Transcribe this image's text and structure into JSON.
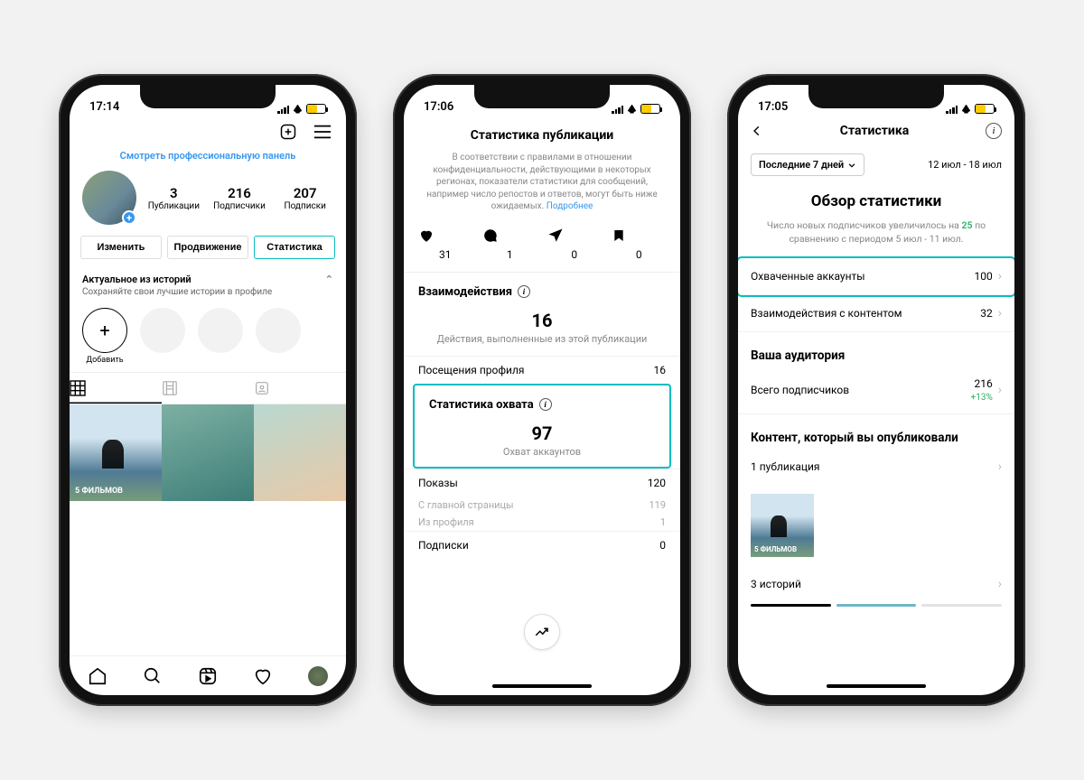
{
  "colors": {
    "accent": "#09bdc0",
    "link": "#3897f0",
    "green": "#27ae60",
    "battery": "#ffcc00"
  },
  "phone1": {
    "time": "17:14",
    "panel_link": "Смотреть профессиональную панель",
    "stats": {
      "posts": {
        "num": "3",
        "label": "Публикации"
      },
      "followers": {
        "num": "216",
        "label": "Подписчики"
      },
      "following": {
        "num": "207",
        "label": "Подписки"
      }
    },
    "tabs": {
      "edit": "Изменить",
      "promo": "Продвижение",
      "stats": "Статистика"
    },
    "highlights_title": "Актуальное из историй",
    "highlights_sub": "Сохраняйте свои лучшие истории в профиле",
    "highlights_add": "Добавить",
    "post1_text": "5 ФИЛЬМОВ"
  },
  "phone2": {
    "time": "17:06",
    "title": "Статистика публикации",
    "info": "В соответствии с правилами в отношении конфиденциальности, действующими в некоторых регионах, показатели статистики для сообщений, например число репостов и ответов, могут быть ниже ожидаемых.",
    "info_link": "Подробнее",
    "icon_counts": {
      "likes": "31",
      "comments": "1",
      "shares": "0",
      "saves": "0"
    },
    "interactions_title": "Взаимодействия",
    "interactions_value": "16",
    "interactions_sub": "Действия, выполненные из этой публикации",
    "profile_visits": {
      "label": "Посещения профиля",
      "value": "16"
    },
    "reach_title": "Статистика охвата",
    "reach_value": "97",
    "reach_sub": "Охват аккаунтов",
    "impressions": {
      "label": "Показы",
      "value": "120"
    },
    "imp_home": {
      "label": "С главной страницы",
      "value": "119"
    },
    "imp_profile": {
      "label": "Из профиля",
      "value": "1"
    },
    "follows": {
      "label": "Подписки",
      "value": "0"
    }
  },
  "phone3": {
    "time": "17:05",
    "title": "Статистика",
    "period": "Последние 7 дней",
    "date_range": "12 июл - 18 июл",
    "h2": "Обзор статистики",
    "sub_pre": "Число новых подписчиков увеличилось на ",
    "sub_green": "25",
    "sub_post": " по сравнению с периодом 5 июл - 11 июл.",
    "rows": {
      "reached": {
        "label": "Охваченные аккаунты",
        "value": "100"
      },
      "interact": {
        "label": "Взаимодействия с контентом",
        "value": "32"
      }
    },
    "aud_title": "Ваша аудитория",
    "aud_row": {
      "label": "Всего подписчиков",
      "value": "216",
      "delta": "+13%"
    },
    "content_title": "Контент, который вы опубликовали",
    "content_row1": "1 публикация",
    "thumb_text": "5 ФИЛЬМОВ",
    "content_row2": "3 историй"
  }
}
